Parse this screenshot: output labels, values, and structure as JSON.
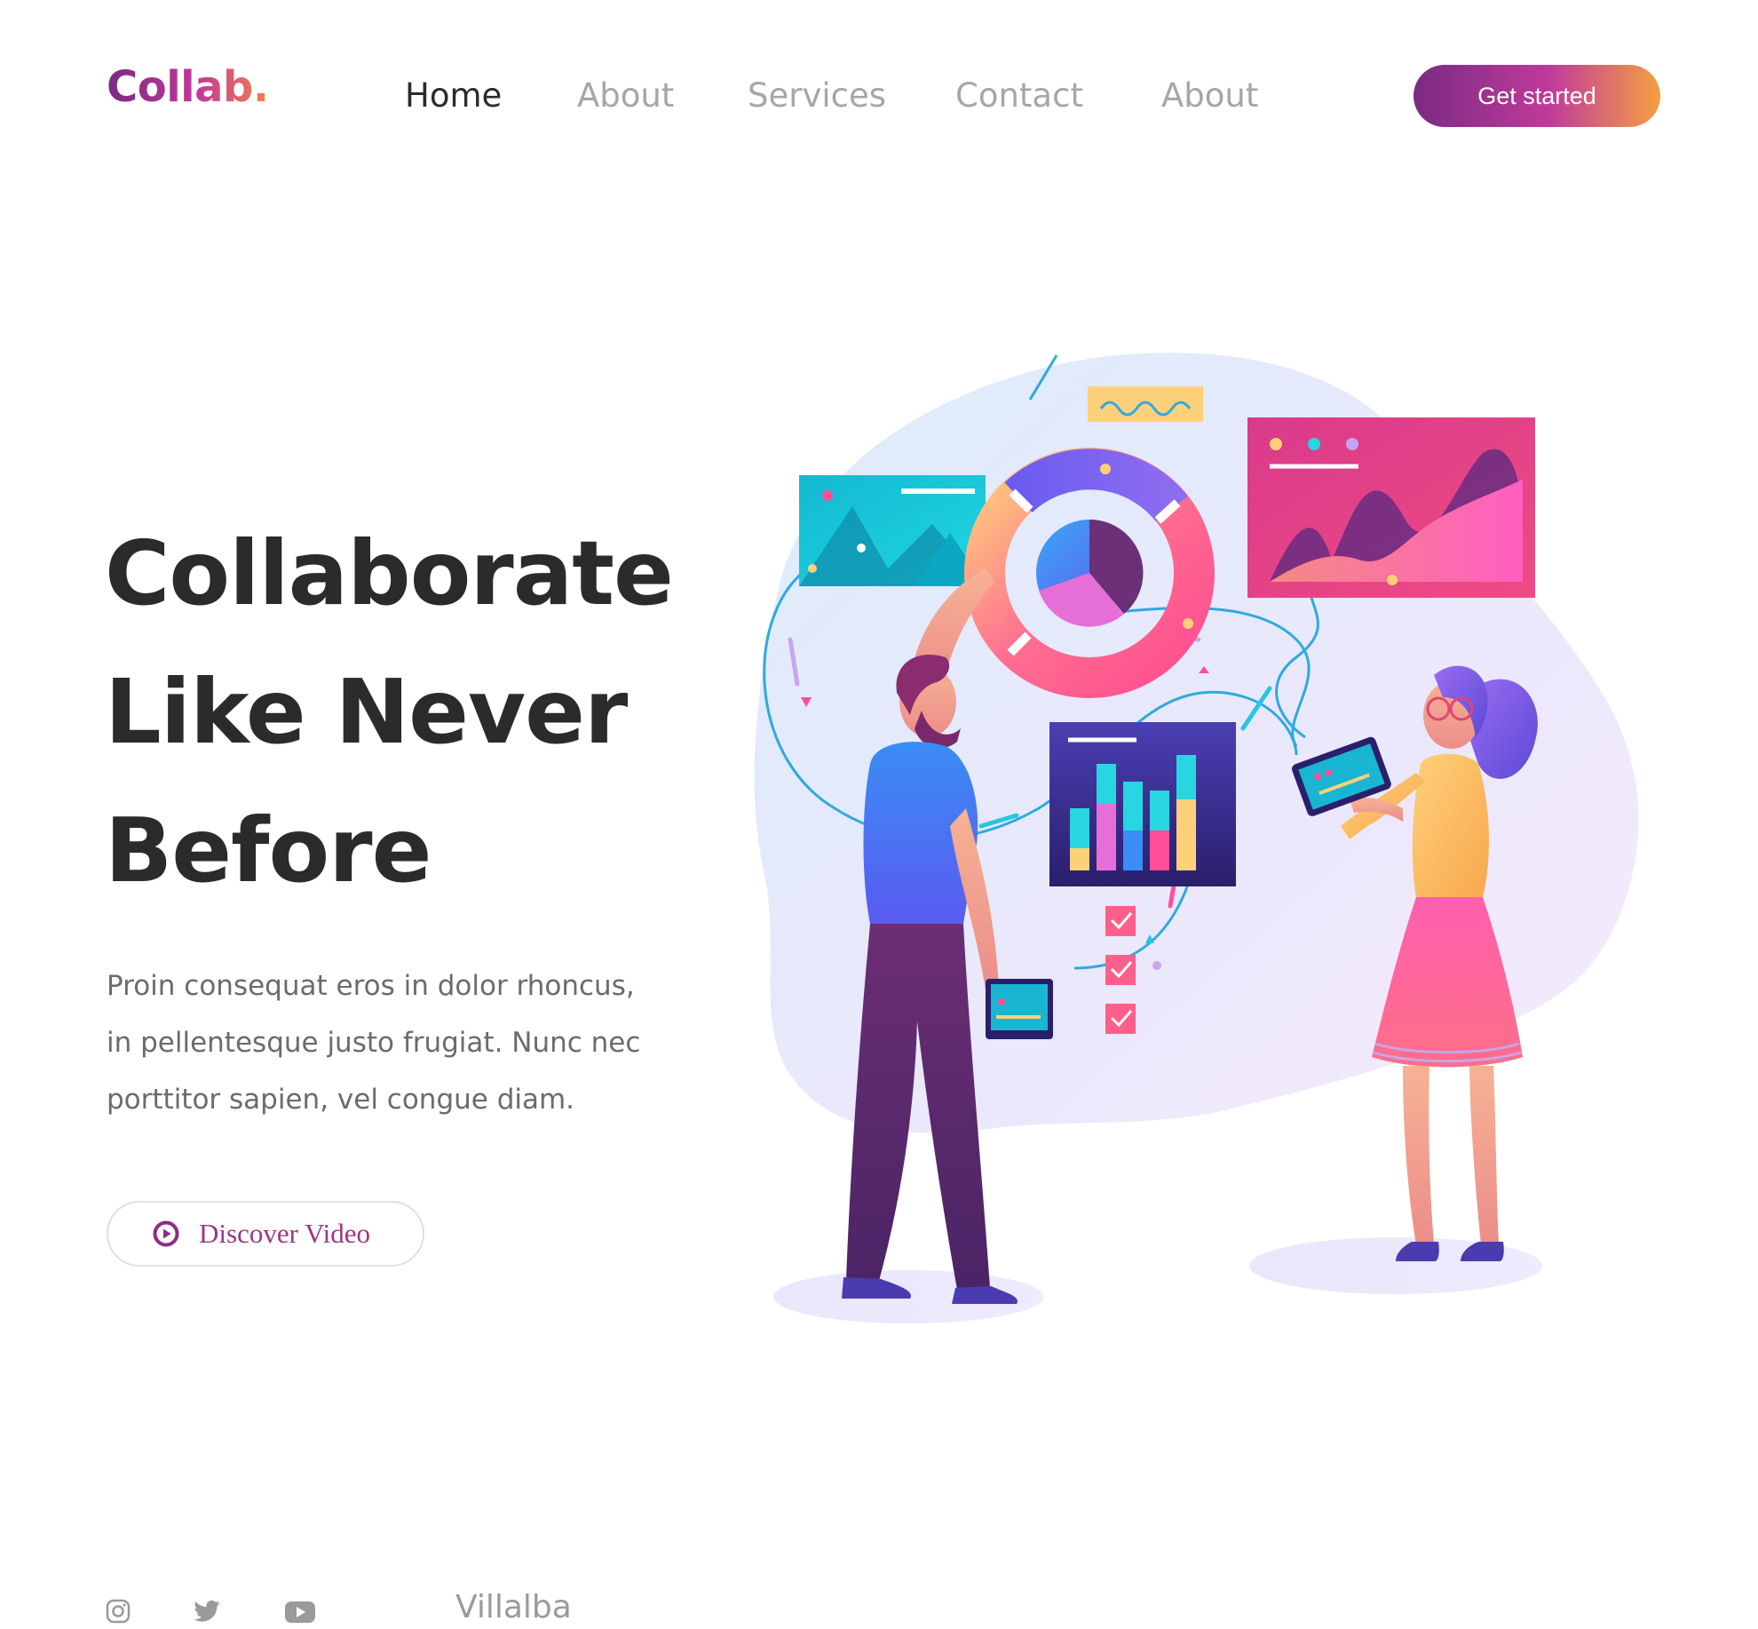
{
  "brand": {
    "logo_text": "Collab."
  },
  "nav": {
    "items": [
      {
        "label": "Home",
        "active": true
      },
      {
        "label": "About",
        "active": false
      },
      {
        "label": "Services",
        "active": false
      },
      {
        "label": "Contact",
        "active": false
      },
      {
        "label": "About",
        "active": false
      }
    ],
    "cta_label": "Get started"
  },
  "hero": {
    "title_lines": [
      "Collaborate",
      "Like Never",
      "Before"
    ],
    "description_lines": [
      "Proin consequat eros in dolor rhoncus,",
      "in pellentesque justo frugiat. Nunc nec",
      "porttitor sapien, vel congue diam."
    ],
    "video_button_label": "Discover Video",
    "video_icon": "play-circle-icon"
  },
  "illustration": {
    "subject": "team-collaboration-illustration"
  },
  "footer": {
    "social_icons": [
      "instagram-icon",
      "twitter-icon",
      "youtube-icon"
    ],
    "brand_text": "Villalba"
  },
  "colors": {
    "brand_purple": "#7a2a83",
    "brand_pink": "#c1379b",
    "brand_orange": "#f5824a",
    "text_dark": "#2b2b2b",
    "text_muted": "#a6a6a6"
  }
}
